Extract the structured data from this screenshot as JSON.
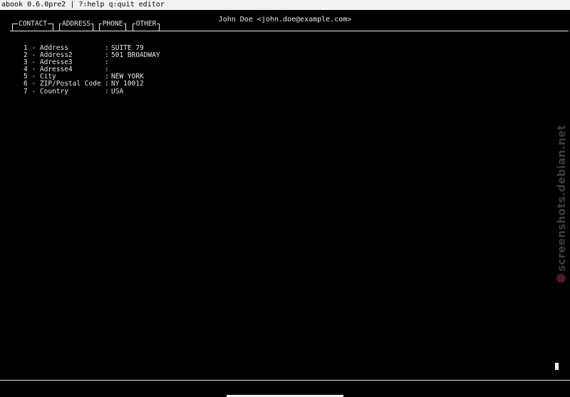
{
  "status_bar": {
    "text": "abook 0.6.0pre2 | ?:help q:quit editor"
  },
  "header": {
    "contact_name": "John Doe <john.doe@example.com>"
  },
  "tabs": [
    {
      "label": "CONTACT"
    },
    {
      "label": "ADDRESS"
    },
    {
      "label": "PHONE"
    },
    {
      "label": "OTHER"
    }
  ],
  "active_tab": "ADDRESS",
  "fields": [
    {
      "label": "1 - Address",
      "sep": ":",
      "value": "SUITE 79"
    },
    {
      "label": "2 - Address2",
      "sep": ":",
      "value": "501 BROADWAY"
    },
    {
      "label": "3 - Adresse3",
      "sep": ":",
      "value": ""
    },
    {
      "label": "4 - Adresse4",
      "sep": ":",
      "value": ""
    },
    {
      "label": "5 - City",
      "sep": ":",
      "value": "NEW YORK"
    },
    {
      "label": "6 - ZIP/Postal Code",
      "sep": ":",
      "value": "NY 10012"
    },
    {
      "label": "7 - Country",
      "sep": ":",
      "value": "USA"
    }
  ],
  "watermark": {
    "text": "screenshots.debian.net",
    "logo_icon": "debian-swirl-icon"
  },
  "colors": {
    "background": "#000000",
    "foreground": "#e8e8e8",
    "status_bar_bg": "#f2f2f2",
    "watermark": "#3c3c3c"
  }
}
